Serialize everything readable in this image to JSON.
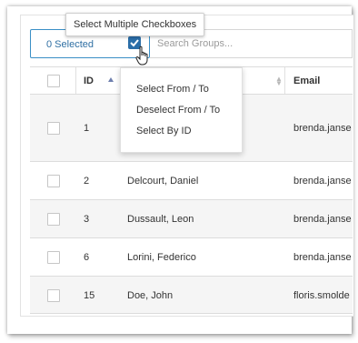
{
  "tooltip": {
    "text": "Select Multiple Checkboxes"
  },
  "selection": {
    "label": "0 Selected"
  },
  "search": {
    "placeholder": "Search Groups..."
  },
  "table": {
    "headers": {
      "id": "ID",
      "name": "",
      "email": "Email"
    },
    "rows": [
      {
        "id": "1",
        "name": "",
        "email": "brenda.janse"
      },
      {
        "id": "2",
        "name": "Delcourt, Daniel",
        "email": "brenda.janse"
      },
      {
        "id": "3",
        "name": "Dussault, Leon",
        "email": "brenda.janse"
      },
      {
        "id": "6",
        "name": "Lorini, Federico",
        "email": "brenda.janse"
      },
      {
        "id": "15",
        "name": "Doe, John",
        "email": "floris.smolde"
      }
    ]
  },
  "menu": {
    "items": [
      "Select From / To",
      "Deselect From / To",
      "Select By ID"
    ]
  },
  "colors": {
    "accent": "#2b6ea8",
    "border_accent": "#3a8fc6",
    "row_alt": "#f5f5f5"
  }
}
